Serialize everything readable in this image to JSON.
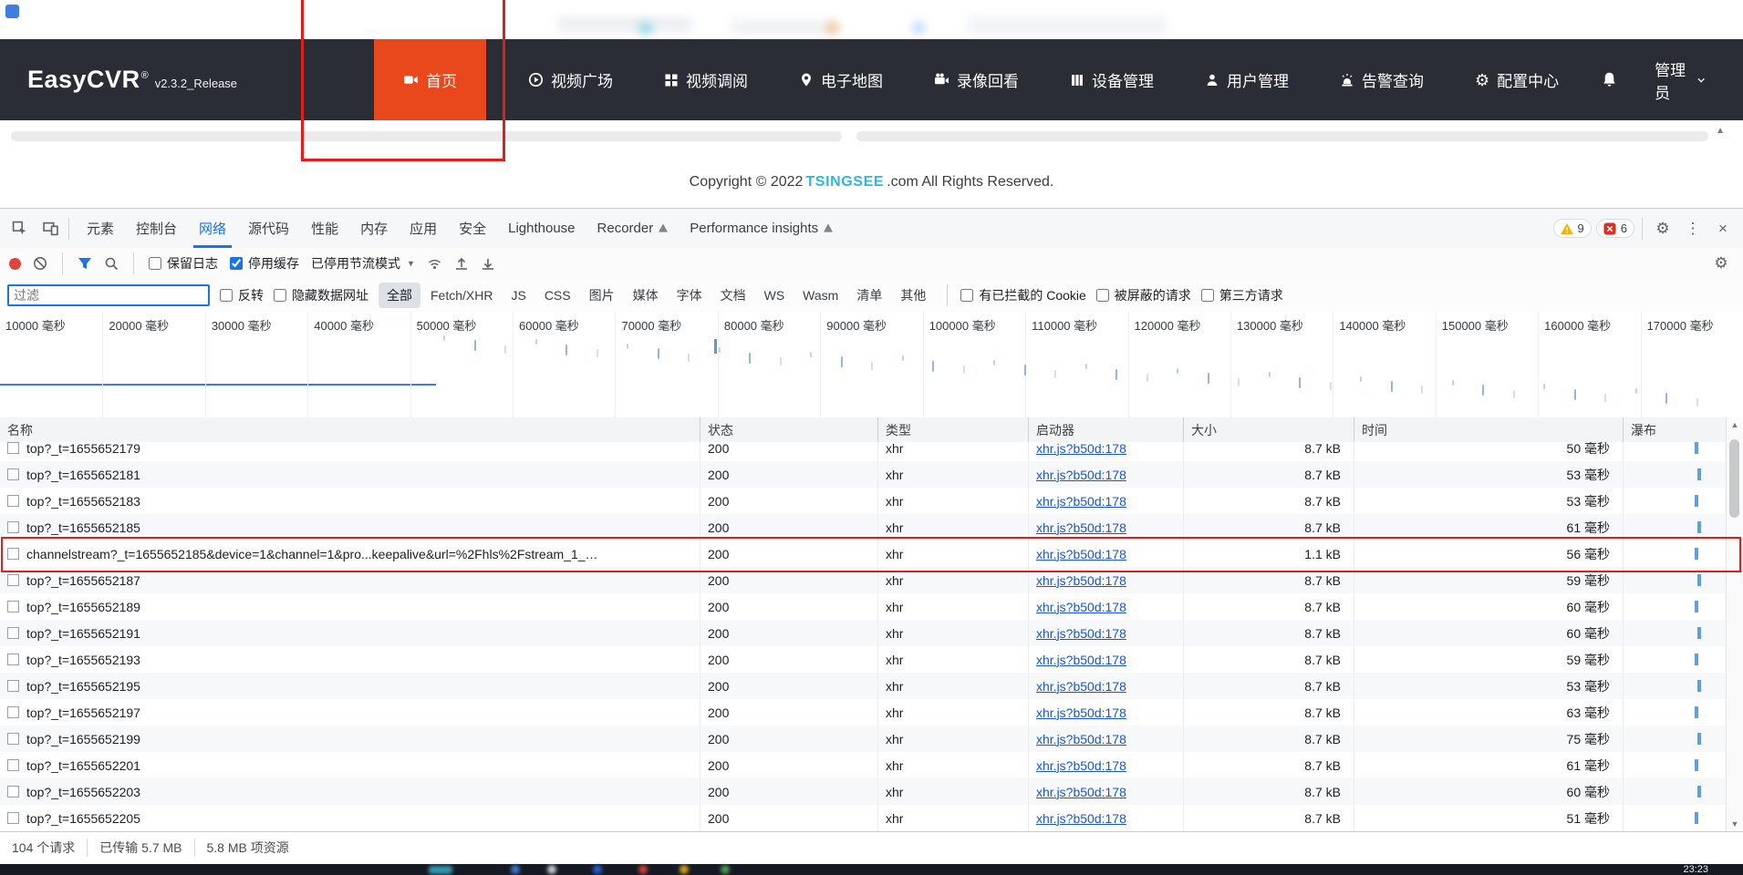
{
  "app": {
    "brand": "EasyCVR",
    "brand_reg": "®",
    "version": "v2.3.2_Release",
    "nav_items": [
      {
        "key": "home",
        "icon": "camera",
        "label": "首页",
        "active": true
      },
      {
        "key": "video-square",
        "icon": "play",
        "label": "视频广场",
        "active": false
      },
      {
        "key": "video-review",
        "icon": "grid",
        "label": "视频调阅",
        "active": false
      },
      {
        "key": "emap",
        "icon": "pin",
        "label": "电子地图",
        "active": false
      },
      {
        "key": "playback",
        "icon": "camcorder",
        "label": "录像回看",
        "active": false
      },
      {
        "key": "devices",
        "icon": "device",
        "label": "设备管理",
        "active": false
      },
      {
        "key": "users",
        "icon": "user",
        "label": "用户管理",
        "active": false
      },
      {
        "key": "alarms",
        "icon": "alarm",
        "label": "告警查询",
        "active": false
      },
      {
        "key": "config",
        "icon": "gear",
        "label": "配置中心",
        "active": false
      }
    ],
    "notification_icon": "bell-icon",
    "user_menu_label": "管理员",
    "copyright": {
      "prefix": "Copyright © 2022 ",
      "brand": "TSINGSEE",
      "suffix": ".com All Rights Reserved."
    }
  },
  "devtools": {
    "tab_bar_icons": [
      "inspect-icon",
      "device-toolbar-icon"
    ],
    "tabs": [
      {
        "label": "元素",
        "badge": false
      },
      {
        "label": "控制台",
        "badge": false
      },
      {
        "label": "网络",
        "badge": false
      },
      {
        "label": "源代码",
        "badge": false
      },
      {
        "label": "性能",
        "badge": false
      },
      {
        "label": "内存",
        "badge": false
      },
      {
        "label": "应用",
        "badge": false
      },
      {
        "label": "安全",
        "badge": false
      },
      {
        "label": "Lighthouse",
        "badge": false
      },
      {
        "label": "Recorder",
        "badge": true
      },
      {
        "label": "Performance insights",
        "badge": true
      }
    ],
    "active_tab_index": 2,
    "badges": {
      "warnings": "9",
      "errors": "6"
    },
    "tab_bar_right_icons": [
      "warning-icon",
      "error-icon",
      "settings-gear-icon",
      "kebab-menu-icon",
      "close-icon"
    ],
    "network_toolbar": {
      "icons": [
        "record-icon",
        "clear-icon",
        "filter-funnel-icon",
        "search-icon",
        "network-conditions-icon",
        "import-har-icon",
        "export-har-icon",
        "settings-gear-icon"
      ],
      "preserve_log_label": "保留日志",
      "preserve_log_checked": false,
      "disable_cache_label": "停用缓存",
      "disable_cache_checked": true,
      "throttling_label": "已停用节流模式"
    },
    "filter_bar": {
      "filter_placeholder": "过滤",
      "invert_label": "反转",
      "hide_data_urls_label": "隐藏数据网址",
      "pills": [
        "全部",
        "Fetch/XHR",
        "JS",
        "CSS",
        "图片",
        "媒体",
        "字体",
        "文档",
        "WS",
        "Wasm",
        "清单",
        "其他"
      ],
      "active_pill_index": 0,
      "blocked_cookies_label": "有已拦截的 Cookie",
      "blocked_requests_label": "被屏蔽的请求",
      "third_party_label": "第三方请求"
    },
    "timeline_labels": [
      "10000 毫秒",
      "20000 毫秒",
      "30000 毫秒",
      "40000 毫秒",
      "50000 毫秒",
      "60000 毫秒",
      "70000 毫秒",
      "80000 毫秒",
      "90000 毫秒",
      "100000 毫秒",
      "110000 毫秒",
      "120000 毫秒",
      "130000 毫秒",
      "140000 毫秒",
      "150000 毫秒",
      "160000 毫秒",
      "170000 毫秒"
    ],
    "table": {
      "columns": [
        "名称",
        "状态",
        "类型",
        "启动器",
        "大小",
        "时间",
        "瀑布"
      ],
      "highlight_row_index": 4,
      "rows": [
        {
          "name": "top?_t=1655652179",
          "status": "200",
          "type": "xhr",
          "initiator": "xhr.js?b50d:178",
          "size": "8.7 kB",
          "time": "50 毫秒"
        },
        {
          "name": "top?_t=1655652181",
          "status": "200",
          "type": "xhr",
          "initiator": "xhr.js?b50d:178",
          "size": "8.7 kB",
          "time": "53 毫秒"
        },
        {
          "name": "top?_t=1655652183",
          "status": "200",
          "type": "xhr",
          "initiator": "xhr.js?b50d:178",
          "size": "8.7 kB",
          "time": "53 毫秒"
        },
        {
          "name": "top?_t=1655652185",
          "status": "200",
          "type": "xhr",
          "initiator": "xhr.js?b50d:178",
          "size": "8.7 kB",
          "time": "61 毫秒"
        },
        {
          "name": "channelstream?_t=1655652185&device=1&channel=1&pro...keepalive&url=%2Fhls%2Fstream_1_…",
          "status": "200",
          "type": "xhr",
          "initiator": "xhr.js?b50d:178",
          "size": "1.1 kB",
          "time": "56 毫秒"
        },
        {
          "name": "top?_t=1655652187",
          "status": "200",
          "type": "xhr",
          "initiator": "xhr.js?b50d:178",
          "size": "8.7 kB",
          "time": "59 毫秒"
        },
        {
          "name": "top?_t=1655652189",
          "status": "200",
          "type": "xhr",
          "initiator": "xhr.js?b50d:178",
          "size": "8.7 kB",
          "time": "60 毫秒"
        },
        {
          "name": "top?_t=1655652191",
          "status": "200",
          "type": "xhr",
          "initiator": "xhr.js?b50d:178",
          "size": "8.7 kB",
          "time": "60 毫秒"
        },
        {
          "name": "top?_t=1655652193",
          "status": "200",
          "type": "xhr",
          "initiator": "xhr.js?b50d:178",
          "size": "8.7 kB",
          "time": "59 毫秒"
        },
        {
          "name": "top?_t=1655652195",
          "status": "200",
          "type": "xhr",
          "initiator": "xhr.js?b50d:178",
          "size": "8.7 kB",
          "time": "53 毫秒"
        },
        {
          "name": "top?_t=1655652197",
          "status": "200",
          "type": "xhr",
          "initiator": "xhr.js?b50d:178",
          "size": "8.7 kB",
          "time": "63 毫秒"
        },
        {
          "name": "top?_t=1655652199",
          "status": "200",
          "type": "xhr",
          "initiator": "xhr.js?b50d:178",
          "size": "8.7 kB",
          "time": "75 毫秒"
        },
        {
          "name": "top?_t=1655652201",
          "status": "200",
          "type": "xhr",
          "initiator": "xhr.js?b50d:178",
          "size": "8.7 kB",
          "time": "61 毫秒"
        },
        {
          "name": "top?_t=1655652203",
          "status": "200",
          "type": "xhr",
          "initiator": "xhr.js?b50d:178",
          "size": "8.7 kB",
          "time": "60 毫秒"
        },
        {
          "name": "top?_t=1655652205",
          "status": "200",
          "type": "xhr",
          "initiator": "xhr.js?b50d:178",
          "size": "8.7 kB",
          "time": "51 毫秒"
        }
      ]
    },
    "summary": [
      "104 个请求",
      "已传输 5.7 MB",
      "5.8 MB 项资源"
    ]
  },
  "taskbar": {
    "clock": "23:23"
  },
  "annotation_color": "#e01e1e"
}
